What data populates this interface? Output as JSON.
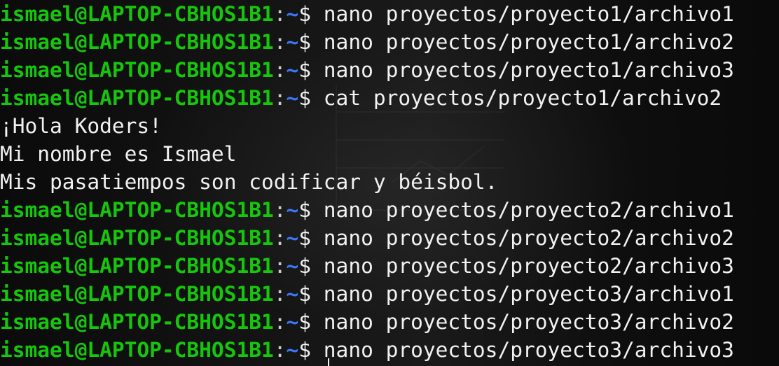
{
  "terminal": {
    "lines": [
      {
        "type": "prompt",
        "user": "ismael@LAPTOP-CBHOS1B1",
        "path": "~",
        "command": "nano proyectos/proyecto1/archivo1"
      },
      {
        "type": "prompt",
        "user": "ismael@LAPTOP-CBHOS1B1",
        "path": "~",
        "command": "nano proyectos/proyecto1/archivo2"
      },
      {
        "type": "prompt",
        "user": "ismael@LAPTOP-CBHOS1B1",
        "path": "~",
        "command": "nano proyectos/proyecto1/archivo3"
      },
      {
        "type": "prompt",
        "user": "ismael@LAPTOP-CBHOS1B1",
        "path": "~",
        "command": "cat proyectos/proyecto1/archivo2"
      },
      {
        "type": "output",
        "text": "¡Hola Koders!"
      },
      {
        "type": "output",
        "text": "Mi nombre es Ismael"
      },
      {
        "type": "output",
        "text": "Mis pasatiempos son codificar y béisbol."
      },
      {
        "type": "prompt",
        "user": "ismael@LAPTOP-CBHOS1B1",
        "path": "~",
        "command": "nano proyectos/proyecto2/archivo1"
      },
      {
        "type": "prompt",
        "user": "ismael@LAPTOP-CBHOS1B1",
        "path": "~",
        "command": "nano proyectos/proyecto2/archivo2"
      },
      {
        "type": "prompt",
        "user": "ismael@LAPTOP-CBHOS1B1",
        "path": "~",
        "command": "nano proyectos/proyecto2/archivo3"
      },
      {
        "type": "prompt",
        "user": "ismael@LAPTOP-CBHOS1B1",
        "path": "~",
        "command": "nano proyectos/proyecto3/archivo1"
      },
      {
        "type": "prompt",
        "user": "ismael@LAPTOP-CBHOS1B1",
        "path": "~",
        "command": "nano proyectos/proyecto3/archivo2"
      },
      {
        "type": "prompt",
        "user": "ismael@LAPTOP-CBHOS1B1",
        "path": "~",
        "command": "nano proyectos/proyecto3/archivo3"
      }
    ],
    "prompt_symbol": "$",
    "separator": ":",
    "colors": {
      "background": "#0c0c0c",
      "user": "#16c60c",
      "path": "#3b78ff",
      "text": "#f2f2f2"
    }
  }
}
